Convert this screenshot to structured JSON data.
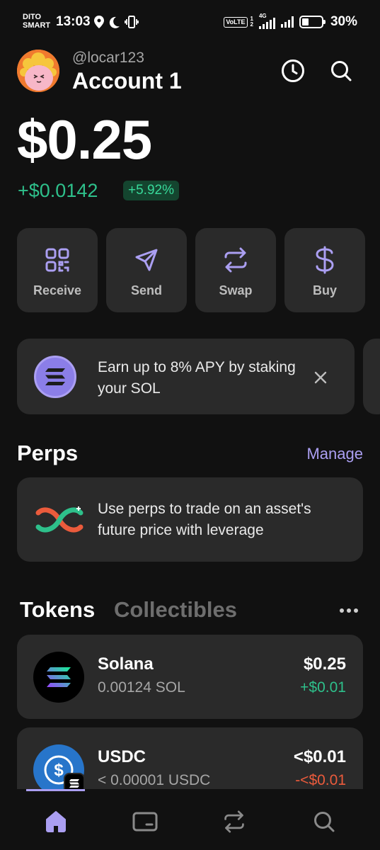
{
  "status_bar": {
    "carrier_line1": "DITO",
    "carrier_line2": "SMART",
    "time": "13:03",
    "volte": "VoLTE",
    "sim1": "1",
    "sim2": "2",
    "network": "4G",
    "battery_pct": "30%"
  },
  "header": {
    "handle": "@locar123",
    "account_name": "Account 1",
    "icons": [
      "history-icon",
      "search-icon"
    ]
  },
  "portfolio": {
    "balance": "$0.25",
    "change_amount": "+$0.0142",
    "change_pct": "+5.92%"
  },
  "actions": [
    {
      "label": "Receive",
      "icon": "qr-code-icon"
    },
    {
      "label": "Send",
      "icon": "send-icon"
    },
    {
      "label": "Swap",
      "icon": "swap-icon"
    },
    {
      "label": "Buy",
      "icon": "dollar-icon"
    }
  ],
  "promo": {
    "text": "Earn up to 8% APY by staking your SOL",
    "icon": "solana-icon"
  },
  "perps": {
    "title": "Perps",
    "manage_label": "Manage",
    "description": "Use perps to trade on an asset's future price with leverage"
  },
  "tabs": {
    "tokens": "Tokens",
    "collectibles": "Collectibles"
  },
  "tokens": [
    {
      "name": "Solana",
      "amount": "0.00124 SOL",
      "value": "$0.25",
      "change": "+$0.01",
      "direction": "up"
    },
    {
      "name": "USDC",
      "amount": "< 0.00001 USDC",
      "value": "<$0.01",
      "change": "-<$0.01",
      "direction": "down"
    }
  ],
  "bottom_nav": [
    "home-icon",
    "wallet-icon",
    "swap-icon",
    "search-icon"
  ],
  "colors": {
    "background": "#111111",
    "card": "#2a2a2a",
    "accent": "#ab9ff2",
    "positive": "#2ec08b",
    "negative": "#eb5b3c"
  }
}
